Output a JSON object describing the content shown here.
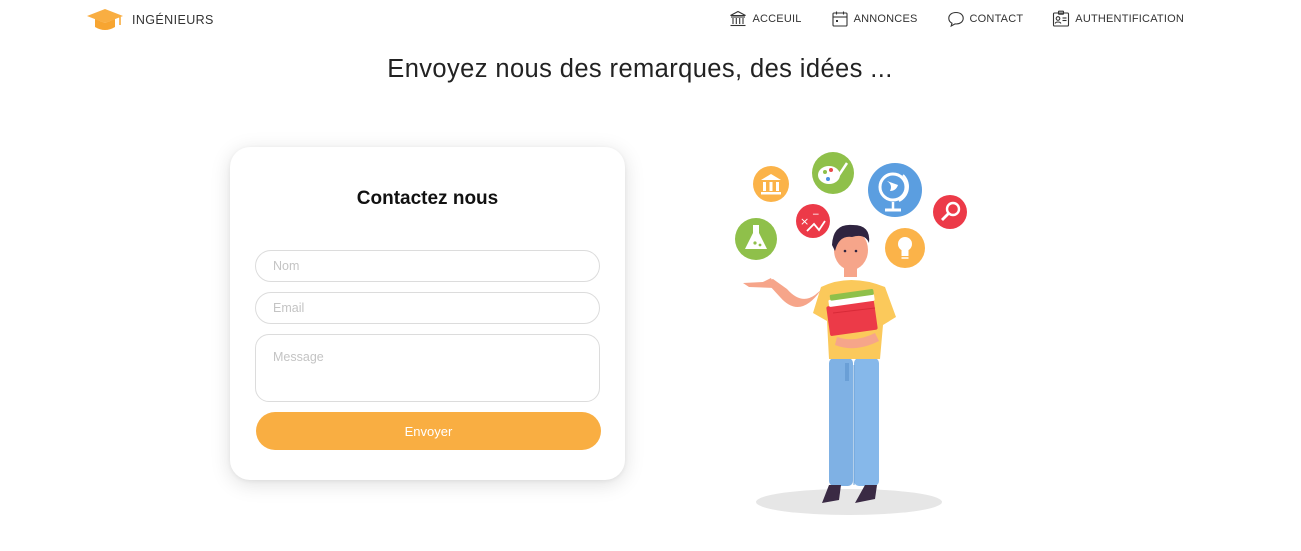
{
  "brand": {
    "name": "INGÉNIEURS",
    "icon": "graduation-cap-icon",
    "color": "#f9ae42"
  },
  "nav": {
    "items": [
      {
        "label": "ACCEUIL",
        "icon": "bank-icon"
      },
      {
        "label": "ANNONCES",
        "icon": "calendar-icon"
      },
      {
        "label": "CONTACT",
        "icon": "chat-bubble-icon"
      },
      {
        "label": "AUTHENTIFICATION",
        "icon": "id-card-icon"
      }
    ]
  },
  "page": {
    "title": "Envoyez nous des remarques, des idées ..."
  },
  "form": {
    "title": "Contactez nous",
    "name_placeholder": "Nom",
    "email_placeholder": "Email",
    "message_placeholder": "Message",
    "submit_label": "Envoyer",
    "accent": "#f9ae42"
  },
  "illustration": {
    "subject": "student holding books with floating subject icons",
    "bubbles": [
      "bank-icon",
      "palette-icon",
      "globe-icon",
      "magnifier-icon",
      "math-icon",
      "flask-icon",
      "lightbulb-icon"
    ]
  }
}
